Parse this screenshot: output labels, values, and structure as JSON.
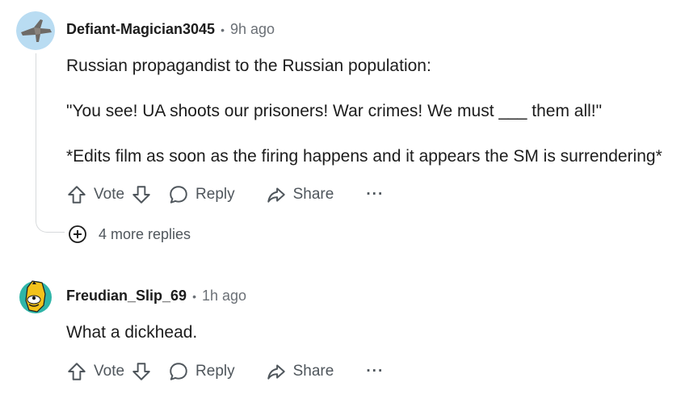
{
  "comments": [
    {
      "author": "Defiant-Magician3045",
      "separator": "•",
      "time": "9h ago",
      "lines": [
        "Russian propagandist to the Russian population:",
        "\"You see! UA shoots our prisoners! War crimes! We must ___ them all!\"",
        "*Edits film as soon as the firing happens and it appears the SM is surrendering*"
      ],
      "vote_label": "Vote",
      "reply_label": "Reply",
      "share_label": "Share",
      "more_label": "···",
      "more_replies": "4 more replies"
    },
    {
      "author": "Freudian_Slip_69",
      "separator": "•",
      "time": "1h ago",
      "lines": [
        "What a dickhead."
      ],
      "vote_label": "Vote",
      "reply_label": "Reply",
      "share_label": "Share",
      "more_label": "···"
    }
  ],
  "icons": {
    "upvote": "arrow-up-icon",
    "downvote": "arrow-down-icon",
    "reply": "speech-bubble-icon",
    "share": "share-arrow-icon",
    "expand": "plus-circle-icon"
  },
  "colors": {
    "text": "#1c1c1c",
    "muted": "#6b7076",
    "thread_line": "#d7dadc"
  }
}
